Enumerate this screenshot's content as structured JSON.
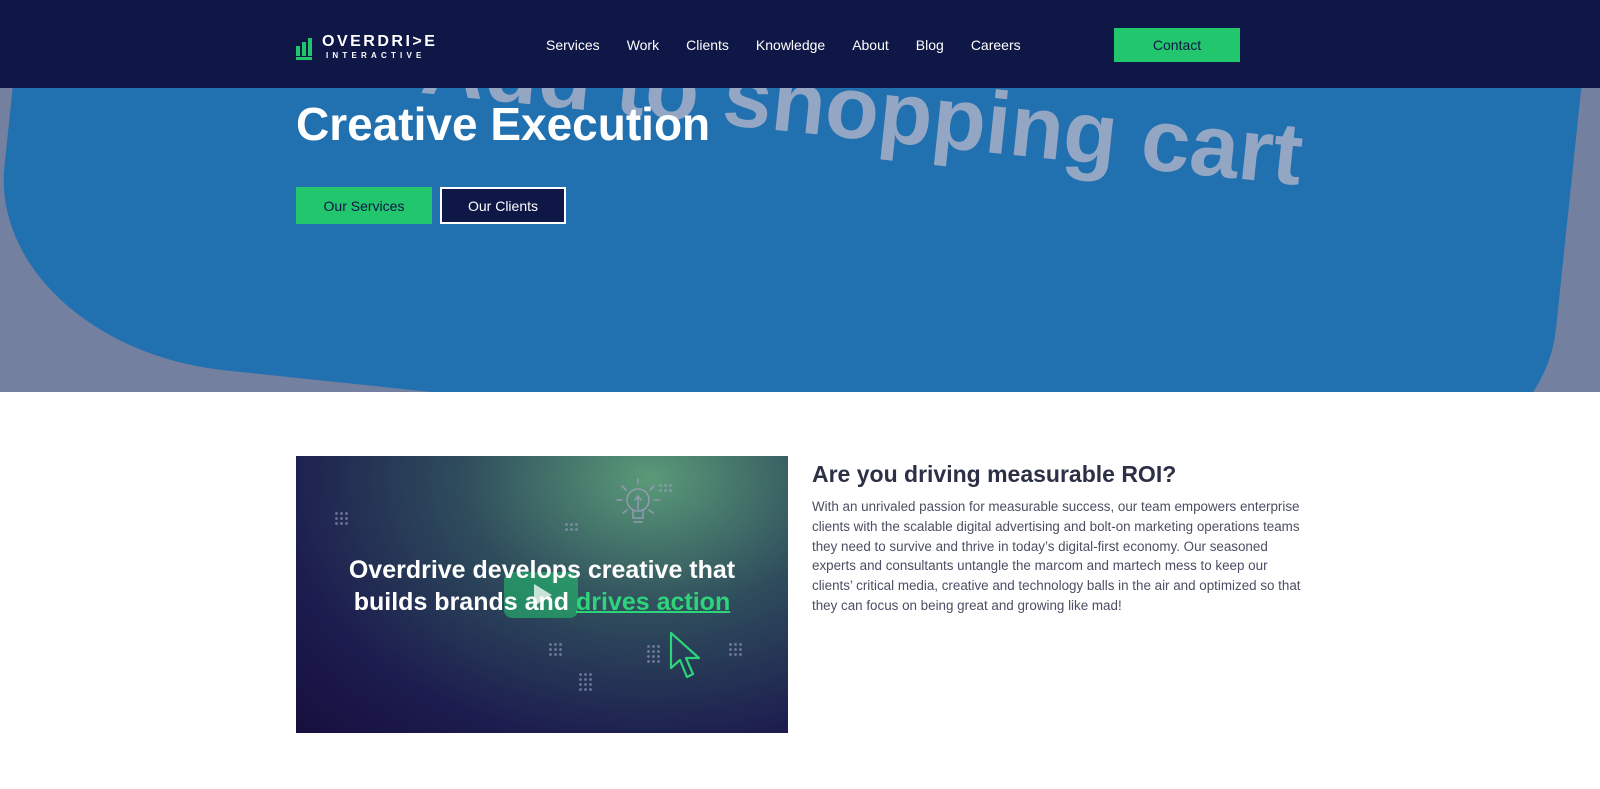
{
  "header": {
    "logo": {
      "main": "OVERDRI>E",
      "sub": "INTERACTIVE"
    },
    "nav": [
      "Services",
      "Work",
      "Clients",
      "Knowledge",
      "About",
      "Blog",
      "Careers"
    ],
    "contact_label": "Contact"
  },
  "hero": {
    "background_text": "Add to shopping cart",
    "title": "Creative Execution",
    "services_button": "Our Services",
    "clients_button": "Our Clients"
  },
  "video": {
    "line1": "Overdrive develops creative that",
    "line2_prefix": "builds brands and ",
    "line2_accent": "drives action"
  },
  "roi": {
    "heading": "Are you driving measurable ROI?",
    "body": "With an unrivaled passion for measurable success, our team empowers enterprise clients with the scalable digital advertising and bolt-on marketing operations teams they need to survive and thrive in today’s digital-first economy. Our seasoned experts and consultants untangle the marcom and martech mess to keep our clients’ critical media, creative and technology balls in the air and optimized so that they can focus on being great and growing like mad!"
  },
  "colors": {
    "navy": "#0f1747",
    "green": "#22c66d",
    "hero_overlay": "#73809f",
    "card_blue": "#1e6fb0"
  }
}
